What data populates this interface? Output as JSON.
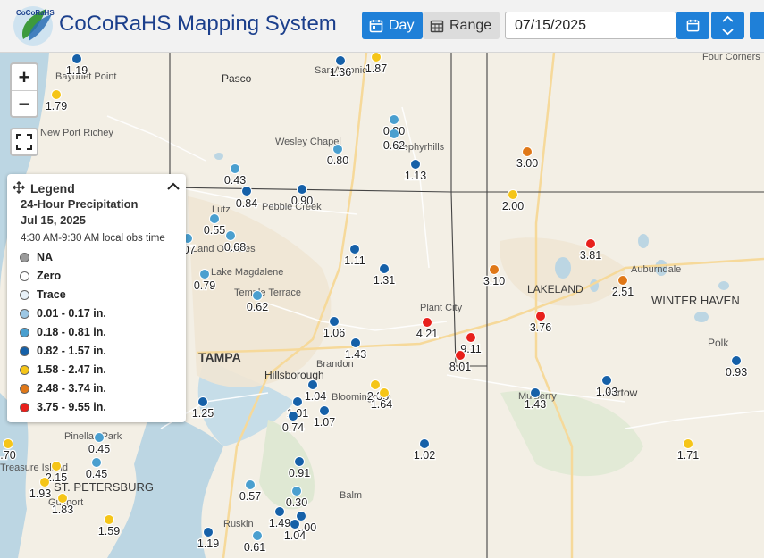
{
  "header": {
    "app_title": "CoCoRaHS Mapping System",
    "logo_text": "CoCoRaHS",
    "day_label": "Day",
    "range_label": "Range",
    "date_value": "07/15/2025"
  },
  "map": {
    "places": [
      "Pasco",
      "Bayonet Point",
      "New Port Richey",
      "Wesley Chapel",
      "Lutz",
      "Pebble Creek",
      "Land O' Lakes",
      "Lake Magdalene",
      "Temple Terrace",
      "TAMPA",
      "Hillsborough",
      "Brandon",
      "Bloomingdale",
      "Plant City",
      "LAKELAND",
      "Auburndale",
      "WINTER HAVEN",
      "Polk",
      "Mulberry",
      "Bartow",
      "Pinellas Park",
      "ST. PETERSBURG",
      "Balm",
      "Ruskin",
      "Four Corners",
      "Treasure Island",
      "Gulfport",
      "Zephyrhills",
      "San Antonio"
    ],
    "stations": [
      {
        "value": "1.19",
        "color": "#1560a8"
      },
      {
        "value": "1.79",
        "color": "#f5c518"
      },
      {
        "value": "1.36",
        "color": "#1560a8"
      },
      {
        "value": "1.87",
        "color": "#f5c518"
      },
      {
        "value": "0.80",
        "color": "#4a9fcf"
      },
      {
        "value": "0.62",
        "color": "#4a9fcf"
      },
      {
        "value": "0.80",
        "color": "#4a9fcf"
      },
      {
        "value": "1.13",
        "color": "#1560a8"
      },
      {
        "value": "0.43",
        "color": "#4a9fcf"
      },
      {
        "value": "0.84",
        "color": "#1560a8"
      },
      {
        "value": "0.90",
        "color": "#1560a8"
      },
      {
        "value": "0.55",
        "color": "#4a9fcf"
      },
      {
        "value": "0.68",
        "color": "#4a9fcf"
      },
      {
        "value": "0.79",
        "color": "#4a9fcf"
      },
      {
        "value": ".07",
        "color": "#4a9fcf"
      },
      {
        "value": "1.11",
        "color": "#1560a8"
      },
      {
        "value": "1.31",
        "color": "#1560a8"
      },
      {
        "value": "0.62",
        "color": "#4a9fcf"
      },
      {
        "value": "3.00",
        "color": "#e07818"
      },
      {
        "value": "2.00",
        "color": "#f5c518"
      },
      {
        "value": "3.81",
        "color": "#e8201c"
      },
      {
        "value": "3.10",
        "color": "#e07818"
      },
      {
        "value": "2.51",
        "color": "#e07818"
      },
      {
        "value": "3.76",
        "color": "#e8201c"
      },
      {
        "value": "4.21",
        "color": "#e8201c"
      },
      {
        "value": "9.11",
        "color": "#e8201c"
      },
      {
        "value": "8.01",
        "color": "#e8201c"
      },
      {
        "value": "1.06",
        "color": "#1560a8"
      },
      {
        "value": "1.43",
        "color": "#1560a8"
      },
      {
        "value": "0.93",
        "color": "#1560a8"
      },
      {
        "value": "1.03",
        "color": "#1560a8"
      },
      {
        "value": "1.43",
        "color": "#1560a8"
      },
      {
        "value": "1.04",
        "color": "#1560a8"
      },
      {
        "value": "1.01",
        "color": "#1560a8"
      },
      {
        "value": "0.74",
        "color": "#1560a8"
      },
      {
        "value": "1.07",
        "color": "#1560a8"
      },
      {
        "value": "2.38",
        "color": "#f5c518"
      },
      {
        "value": "1.64",
        "color": "#f5c518"
      },
      {
        "value": "1.25",
        "color": "#1560a8"
      },
      {
        "value": "1.02",
        "color": "#1560a8"
      },
      {
        "value": "1.71",
        "color": "#f5c518"
      },
      {
        "value": "0.91",
        "color": "#1560a8"
      },
      {
        "value": "0.57",
        "color": "#4a9fcf"
      },
      {
        "value": "0.30",
        "color": "#4a9fcf"
      },
      {
        "value": "1.49",
        "color": "#1560a8"
      },
      {
        "value": "1.00",
        "color": "#1560a8"
      },
      {
        "value": "1.04",
        "color": "#1560a8"
      },
      {
        "value": "1.19",
        "color": "#1560a8"
      },
      {
        "value": "0.61",
        "color": "#4a9fcf"
      },
      {
        "value": "0.45",
        "color": "#4a9fcf"
      },
      {
        "value": "0.45",
        "color": "#4a9fcf"
      },
      {
        "value": ".70",
        "color": "#f5c518"
      },
      {
        "value": "2.15",
        "color": "#f5c518"
      },
      {
        "value": "1.83",
        "color": "#f5c518"
      },
      {
        "value": "1.59",
        "color": "#f5c518"
      },
      {
        "value": "1.93",
        "color": "#f5c518"
      }
    ]
  },
  "legend": {
    "title": "Legend",
    "subtitle": "24-Hour Precipitation",
    "date": "Jul 15, 2025",
    "obs_time": "4:30 AM-9:30 AM local obs time",
    "items": [
      {
        "label": "NA",
        "color": "#9a9a9a"
      },
      {
        "label": "Zero",
        "color": "#ffffff"
      },
      {
        "label": "Trace",
        "color": "#e8f1f8"
      },
      {
        "label": "0.01 - 0.17 in.",
        "color": "#9cc7e4"
      },
      {
        "label": "0.18 - 0.81 in.",
        "color": "#4a9fcf"
      },
      {
        "label": "0.82 - 1.57 in.",
        "color": "#1560a8"
      },
      {
        "label": "1.58 - 2.47 in.",
        "color": "#f5c518"
      },
      {
        "label": "2.48 - 3.74 in.",
        "color": "#e07818"
      },
      {
        "label": "3.75 - 9.55 in.",
        "color": "#e8201c"
      }
    ]
  }
}
